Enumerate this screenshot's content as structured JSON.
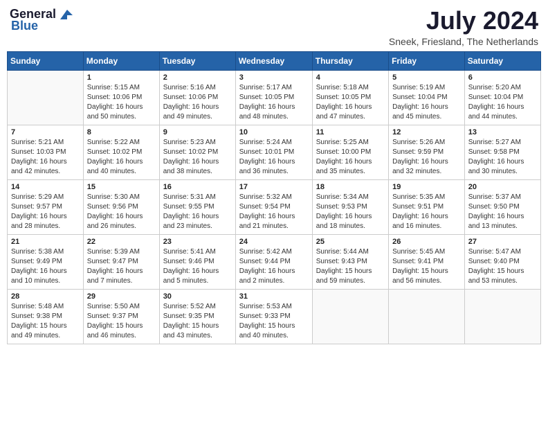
{
  "header": {
    "logo_general": "General",
    "logo_blue": "Blue",
    "month_year": "July 2024",
    "location": "Sneek, Friesland, The Netherlands"
  },
  "weekdays": [
    "Sunday",
    "Monday",
    "Tuesday",
    "Wednesday",
    "Thursday",
    "Friday",
    "Saturday"
  ],
  "weeks": [
    [
      {
        "day": "",
        "info": ""
      },
      {
        "day": "1",
        "info": "Sunrise: 5:15 AM\nSunset: 10:06 PM\nDaylight: 16 hours\nand 50 minutes."
      },
      {
        "day": "2",
        "info": "Sunrise: 5:16 AM\nSunset: 10:06 PM\nDaylight: 16 hours\nand 49 minutes."
      },
      {
        "day": "3",
        "info": "Sunrise: 5:17 AM\nSunset: 10:05 PM\nDaylight: 16 hours\nand 48 minutes."
      },
      {
        "day": "4",
        "info": "Sunrise: 5:18 AM\nSunset: 10:05 PM\nDaylight: 16 hours\nand 47 minutes."
      },
      {
        "day": "5",
        "info": "Sunrise: 5:19 AM\nSunset: 10:04 PM\nDaylight: 16 hours\nand 45 minutes."
      },
      {
        "day": "6",
        "info": "Sunrise: 5:20 AM\nSunset: 10:04 PM\nDaylight: 16 hours\nand 44 minutes."
      }
    ],
    [
      {
        "day": "7",
        "info": "Sunrise: 5:21 AM\nSunset: 10:03 PM\nDaylight: 16 hours\nand 42 minutes."
      },
      {
        "day": "8",
        "info": "Sunrise: 5:22 AM\nSunset: 10:02 PM\nDaylight: 16 hours\nand 40 minutes."
      },
      {
        "day": "9",
        "info": "Sunrise: 5:23 AM\nSunset: 10:02 PM\nDaylight: 16 hours\nand 38 minutes."
      },
      {
        "day": "10",
        "info": "Sunrise: 5:24 AM\nSunset: 10:01 PM\nDaylight: 16 hours\nand 36 minutes."
      },
      {
        "day": "11",
        "info": "Sunrise: 5:25 AM\nSunset: 10:00 PM\nDaylight: 16 hours\nand 35 minutes."
      },
      {
        "day": "12",
        "info": "Sunrise: 5:26 AM\nSunset: 9:59 PM\nDaylight: 16 hours\nand 32 minutes."
      },
      {
        "day": "13",
        "info": "Sunrise: 5:27 AM\nSunset: 9:58 PM\nDaylight: 16 hours\nand 30 minutes."
      }
    ],
    [
      {
        "day": "14",
        "info": "Sunrise: 5:29 AM\nSunset: 9:57 PM\nDaylight: 16 hours\nand 28 minutes."
      },
      {
        "day": "15",
        "info": "Sunrise: 5:30 AM\nSunset: 9:56 PM\nDaylight: 16 hours\nand 26 minutes."
      },
      {
        "day": "16",
        "info": "Sunrise: 5:31 AM\nSunset: 9:55 PM\nDaylight: 16 hours\nand 23 minutes."
      },
      {
        "day": "17",
        "info": "Sunrise: 5:32 AM\nSunset: 9:54 PM\nDaylight: 16 hours\nand 21 minutes."
      },
      {
        "day": "18",
        "info": "Sunrise: 5:34 AM\nSunset: 9:53 PM\nDaylight: 16 hours\nand 18 minutes."
      },
      {
        "day": "19",
        "info": "Sunrise: 5:35 AM\nSunset: 9:51 PM\nDaylight: 16 hours\nand 16 minutes."
      },
      {
        "day": "20",
        "info": "Sunrise: 5:37 AM\nSunset: 9:50 PM\nDaylight: 16 hours\nand 13 minutes."
      }
    ],
    [
      {
        "day": "21",
        "info": "Sunrise: 5:38 AM\nSunset: 9:49 PM\nDaylight: 16 hours\nand 10 minutes."
      },
      {
        "day": "22",
        "info": "Sunrise: 5:39 AM\nSunset: 9:47 PM\nDaylight: 16 hours\nand 7 minutes."
      },
      {
        "day": "23",
        "info": "Sunrise: 5:41 AM\nSunset: 9:46 PM\nDaylight: 16 hours\nand 5 minutes."
      },
      {
        "day": "24",
        "info": "Sunrise: 5:42 AM\nSunset: 9:44 PM\nDaylight: 16 hours\nand 2 minutes."
      },
      {
        "day": "25",
        "info": "Sunrise: 5:44 AM\nSunset: 9:43 PM\nDaylight: 15 hours\nand 59 minutes."
      },
      {
        "day": "26",
        "info": "Sunrise: 5:45 AM\nSunset: 9:41 PM\nDaylight: 15 hours\nand 56 minutes."
      },
      {
        "day": "27",
        "info": "Sunrise: 5:47 AM\nSunset: 9:40 PM\nDaylight: 15 hours\nand 53 minutes."
      }
    ],
    [
      {
        "day": "28",
        "info": "Sunrise: 5:48 AM\nSunset: 9:38 PM\nDaylight: 15 hours\nand 49 minutes."
      },
      {
        "day": "29",
        "info": "Sunrise: 5:50 AM\nSunset: 9:37 PM\nDaylight: 15 hours\nand 46 minutes."
      },
      {
        "day": "30",
        "info": "Sunrise: 5:52 AM\nSunset: 9:35 PM\nDaylight: 15 hours\nand 43 minutes."
      },
      {
        "day": "31",
        "info": "Sunrise: 5:53 AM\nSunset: 9:33 PM\nDaylight: 15 hours\nand 40 minutes."
      },
      {
        "day": "",
        "info": ""
      },
      {
        "day": "",
        "info": ""
      },
      {
        "day": "",
        "info": ""
      }
    ]
  ]
}
